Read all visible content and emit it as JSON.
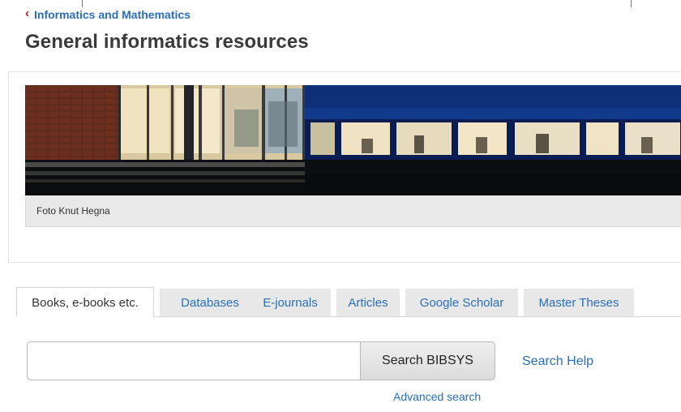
{
  "breadcrumb": {
    "parent_label": "Informatics and Mathematics"
  },
  "page": {
    "title": "General informatics resources"
  },
  "hero": {
    "caption": "Foto Knut Hegna"
  },
  "tabs": [
    {
      "label": "Books, e-books etc.",
      "active": true
    },
    {
      "label": "Databases",
      "active": false
    },
    {
      "label": "E-journals",
      "active": false
    },
    {
      "label": "Articles",
      "active": false
    },
    {
      "label": "Google Scholar",
      "active": false
    },
    {
      "label": "Master Theses",
      "active": false
    }
  ],
  "search": {
    "input_value": "",
    "button_label": "Search BIBSYS",
    "help_label": "Search Help",
    "advanced_label": "Advanced search"
  },
  "colors": {
    "link": "#2a6ebb",
    "chevron": "#c8102e",
    "tab_inactive_bg": "#e8e8e8",
    "caption_bg": "#e9e9e9"
  }
}
